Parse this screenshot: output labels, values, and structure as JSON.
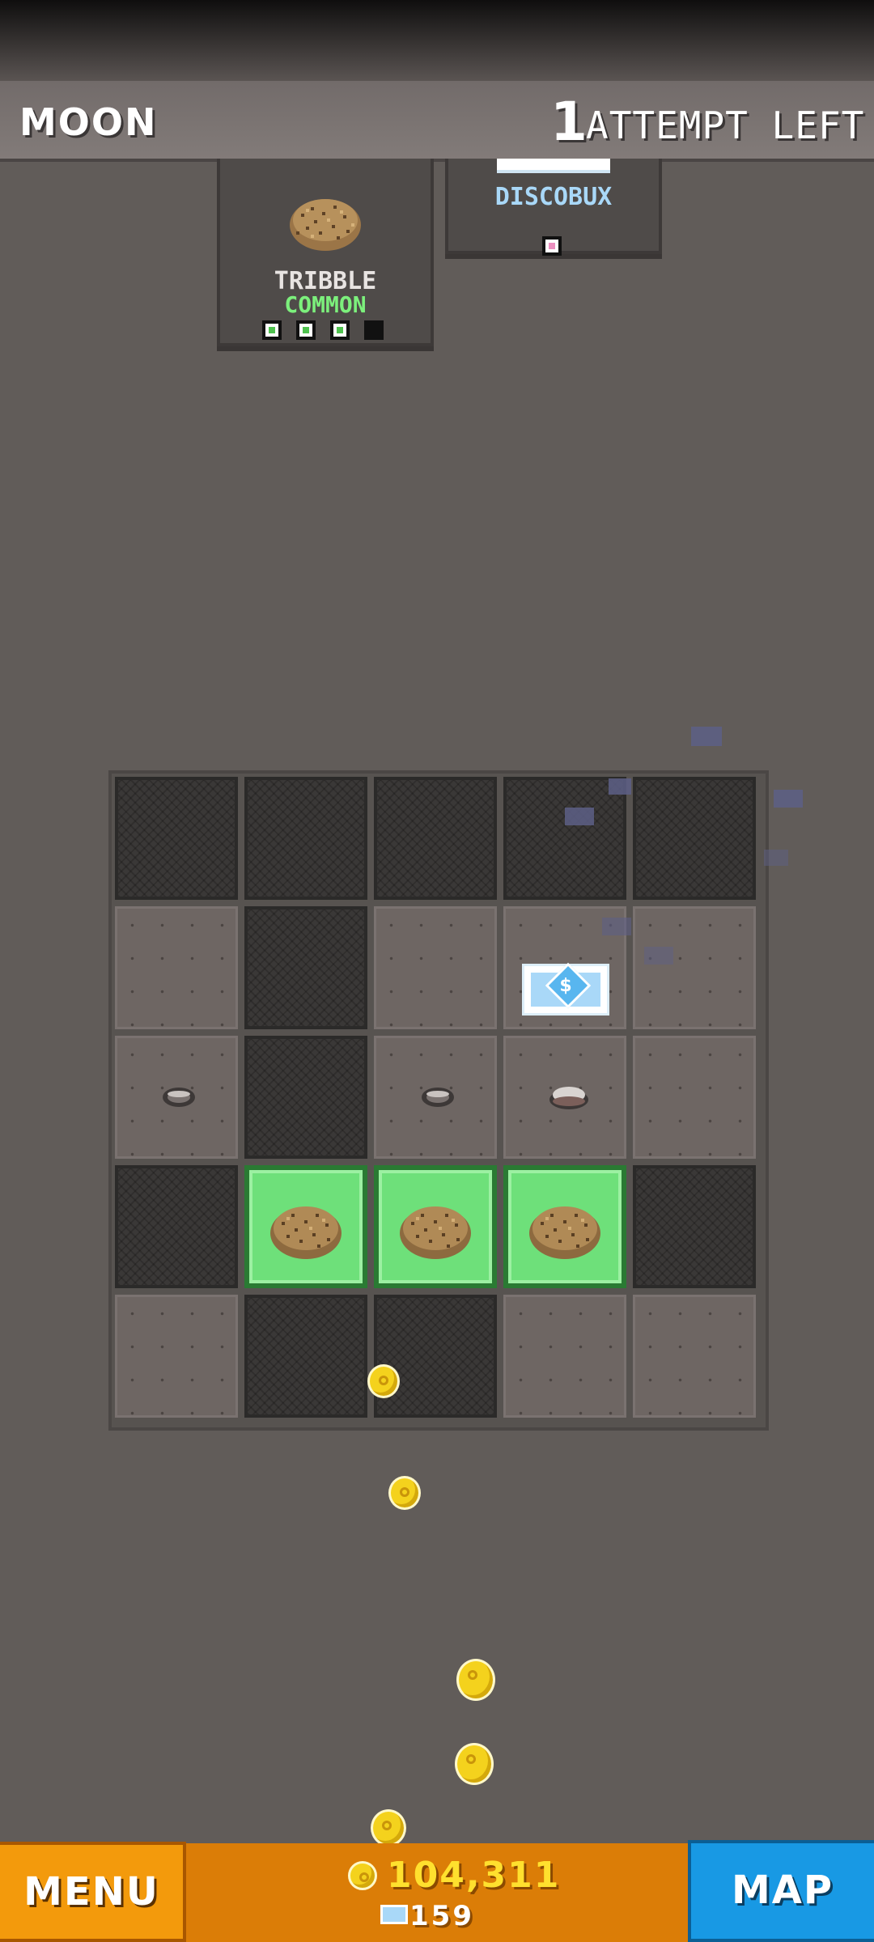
{
  "header": {
    "location": "MOON",
    "attempts_count": "1",
    "attempts_label": "ATTEMPT LEFT"
  },
  "collection": [
    {
      "name": "TRIBBLE",
      "rarity": "COMMON",
      "rarity_color": "#7cf07c",
      "pips_total": 4,
      "pips_filled": 3
    },
    {
      "name": "DISCOBUX",
      "name_color": "#a9d8f8",
      "pips_total": 1,
      "pips_filled": 1,
      "pip_color": "#ec8fc0"
    }
  ],
  "grid": {
    "size": 5,
    "rows": [
      [
        "covered",
        "covered",
        "covered",
        "covered",
        "covered"
      ],
      [
        "dug",
        "covered",
        "dug",
        "dug-discobux",
        "dug"
      ],
      [
        "dug-pebble",
        "covered",
        "dug-pebble",
        "dug-rock",
        "dug"
      ],
      [
        "covered",
        "tribble",
        "tribble",
        "tribble",
        "covered"
      ],
      [
        "dug",
        "covered",
        "covered",
        "dug",
        "dug"
      ]
    ]
  },
  "footer": {
    "menu_label": "MENU",
    "map_label": "MAP",
    "coins": "104,311",
    "discobux": "159"
  },
  "icons": {
    "tribble": "tribble-icon",
    "discobux": "discobux-bill-icon",
    "coin": "coin-icon"
  },
  "colors": {
    "found_tile": "#6ee07a",
    "menu": "#f39a0c",
    "map": "#1899e4",
    "coin": "#f4d21d"
  }
}
